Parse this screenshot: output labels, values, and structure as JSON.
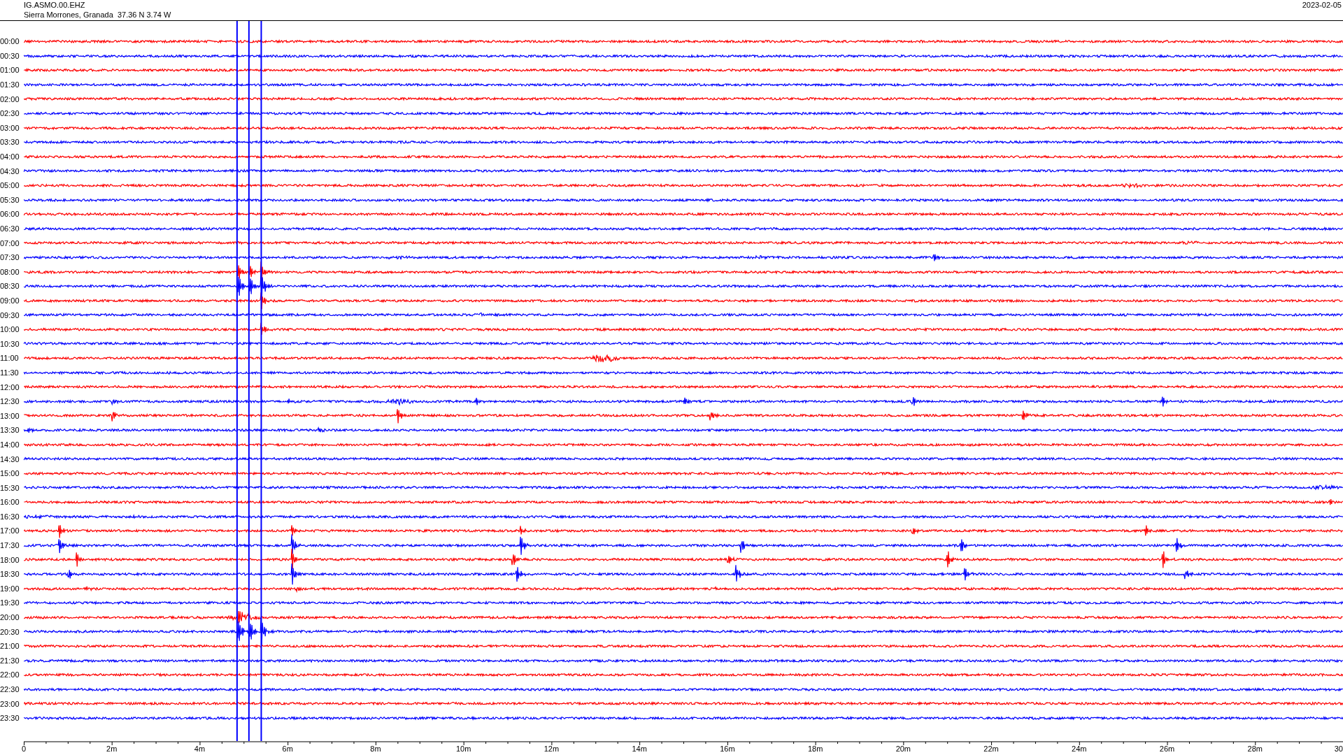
{
  "header": {
    "station": "IG.ASMO.00.EHZ",
    "location": "Sierra Morrones, Granada  37.36 N 3.74 W",
    "date": "2023-02-05"
  },
  "rows": [
    {
      "label": "00:00",
      "color": "#ff0000"
    },
    {
      "label": "00:30",
      "color": "#0000ff"
    },
    {
      "label": "01:00",
      "color": "#ff0000"
    },
    {
      "label": "01:30",
      "color": "#0000ff"
    },
    {
      "label": "02:00",
      "color": "#ff0000"
    },
    {
      "label": "02:30",
      "color": "#0000ff"
    },
    {
      "label": "03:00",
      "color": "#ff0000"
    },
    {
      "label": "03:30",
      "color": "#0000ff"
    },
    {
      "label": "04:00",
      "color": "#ff0000"
    },
    {
      "label": "04:30",
      "color": "#0000ff"
    },
    {
      "label": "05:00",
      "color": "#ff0000"
    },
    {
      "label": "05:30",
      "color": "#0000ff"
    },
    {
      "label": "06:00",
      "color": "#ff0000"
    },
    {
      "label": "06:30",
      "color": "#0000ff"
    },
    {
      "label": "07:00",
      "color": "#ff0000"
    },
    {
      "label": "07:30",
      "color": "#0000ff"
    },
    {
      "label": "08:00",
      "color": "#ff0000"
    },
    {
      "label": "08:30",
      "color": "#0000ff"
    },
    {
      "label": "09:00",
      "color": "#ff0000"
    },
    {
      "label": "09:30",
      "color": "#0000ff"
    },
    {
      "label": "10:00",
      "color": "#ff0000"
    },
    {
      "label": "10:30",
      "color": "#0000ff"
    },
    {
      "label": "11:00",
      "color": "#ff0000"
    },
    {
      "label": "11:30",
      "color": "#0000ff"
    },
    {
      "label": "12:00",
      "color": "#ff0000"
    },
    {
      "label": "12:30",
      "color": "#0000ff"
    },
    {
      "label": "13:00",
      "color": "#ff0000"
    },
    {
      "label": "13:30",
      "color": "#0000ff"
    },
    {
      "label": "14:00",
      "color": "#ff0000"
    },
    {
      "label": "14:30",
      "color": "#0000ff"
    },
    {
      "label": "15:00",
      "color": "#ff0000"
    },
    {
      "label": "15:30",
      "color": "#0000ff"
    },
    {
      "label": "16:00",
      "color": "#ff0000"
    },
    {
      "label": "16:30",
      "color": "#0000ff"
    },
    {
      "label": "17:00",
      "color": "#ff0000"
    },
    {
      "label": "17:30",
      "color": "#0000ff"
    },
    {
      "label": "18:00",
      "color": "#ff0000"
    },
    {
      "label": "18:30",
      "color": "#0000ff"
    },
    {
      "label": "19:00",
      "color": "#ff0000"
    },
    {
      "label": "19:30",
      "color": "#0000ff"
    },
    {
      "label": "20:00",
      "color": "#ff0000"
    },
    {
      "label": "20:30",
      "color": "#0000ff"
    },
    {
      "label": "21:00",
      "color": "#ff0000"
    },
    {
      "label": "21:30",
      "color": "#0000ff"
    },
    {
      "label": "22:00",
      "color": "#ff0000"
    },
    {
      "label": "22:30",
      "color": "#0000ff"
    },
    {
      "label": "23:00",
      "color": "#ff0000"
    },
    {
      "label": "23:30",
      "color": "#0000ff"
    }
  ],
  "time_axis": {
    "ticks": [
      "0",
      "2m",
      "4m",
      "6m",
      "8m",
      "10m",
      "12m",
      "14m",
      "16m",
      "18m",
      "20m",
      "22m",
      "24m",
      "26m",
      "28m",
      "30"
    ]
  }
}
